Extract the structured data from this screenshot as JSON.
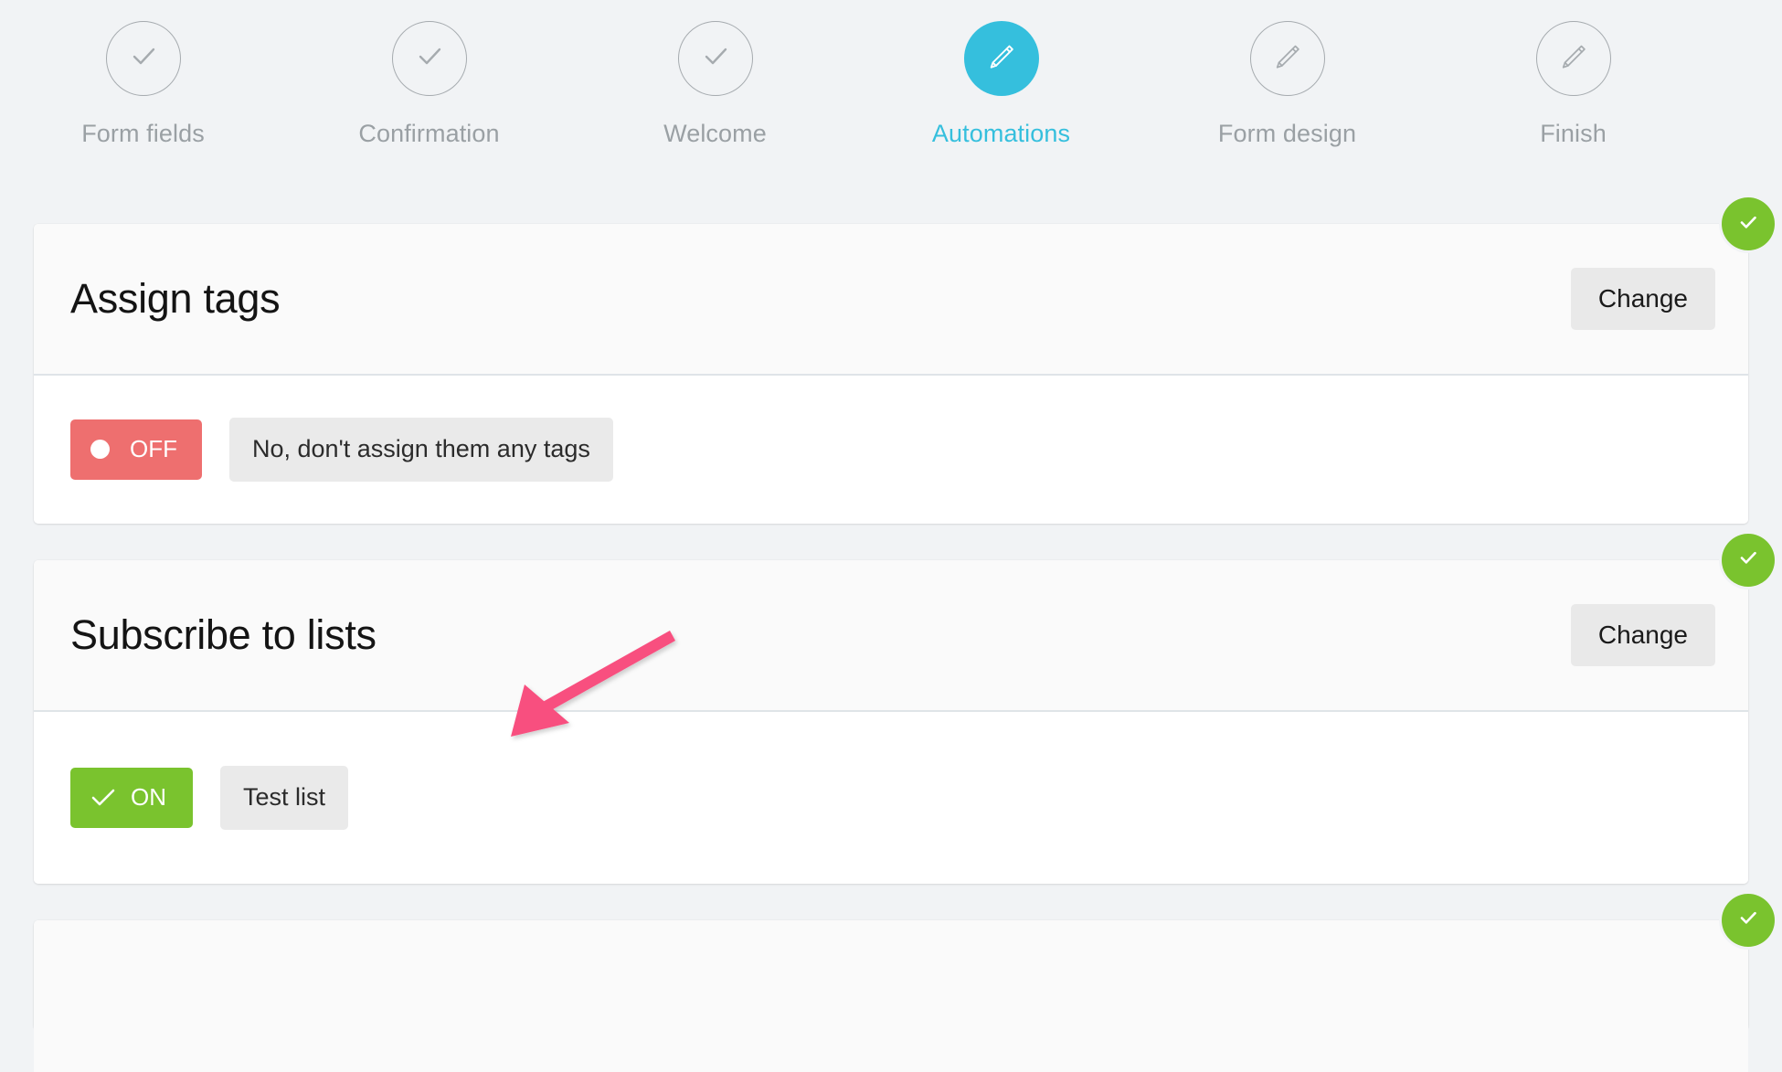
{
  "stepper": {
    "steps": [
      {
        "label": "Form fields",
        "state": "done",
        "icon": "check-icon"
      },
      {
        "label": "Confirmation",
        "state": "done",
        "icon": "check-icon"
      },
      {
        "label": "Welcome",
        "state": "done",
        "icon": "check-icon"
      },
      {
        "label": "Automations",
        "state": "active",
        "icon": "pencil-icon"
      },
      {
        "label": "Form design",
        "state": "todo",
        "icon": "pencil-icon"
      },
      {
        "label": "Finish",
        "state": "todo",
        "icon": "pencil-icon"
      }
    ],
    "active_color": "#35bfdd",
    "inactive_color": "#9aa0a4"
  },
  "cards": [
    {
      "title": "Assign tags",
      "change_label": "Change",
      "badge_icon": "check-icon",
      "badge_color": "#7ac32e",
      "toggle": {
        "state": "OFF",
        "label": "OFF",
        "color": "#ee6f6f",
        "icon": "dot-icon"
      },
      "value_chip": "No, don't assign them any tags"
    },
    {
      "title": "Subscribe to lists",
      "change_label": "Change",
      "badge_icon": "check-icon",
      "badge_color": "#7ac32e",
      "toggle": {
        "state": "ON",
        "label": "ON",
        "color": "#7ac32e",
        "icon": "check-icon"
      },
      "value_chip": "Test list"
    },
    {
      "title": "",
      "change_label": "",
      "badge_icon": "check-icon",
      "badge_color": "#7ac32e",
      "toggle": {
        "state": "",
        "label": "",
        "color": "#7ac32e",
        "icon": "check-icon"
      },
      "value_chip": ""
    }
  ],
  "annotation": {
    "type": "arrow",
    "color": "#f84f7f",
    "points_to": "toggle-and-list-chip"
  }
}
